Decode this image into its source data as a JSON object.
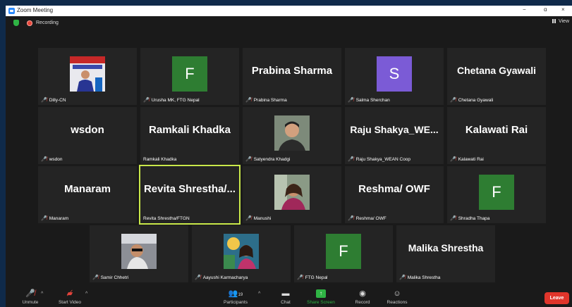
{
  "window": {
    "title": "Zoom Meeting",
    "minimize": "−",
    "restore": "ɑ",
    "close": "×"
  },
  "status": {
    "recording_label": "Recording",
    "view_label": "View"
  },
  "tiles": {
    "dilly": {
      "label": "Dilly-CN",
      "muted": true
    },
    "urusha": {
      "label": "Urusha MK, FTG Nepal",
      "avatar_letter": "F",
      "avatar_color": "#2e7d32",
      "muted": true
    },
    "prabina": {
      "big_name": "Prabina Sharma",
      "label": "Prabina Sharma",
      "muted": true
    },
    "salma": {
      "label": "Salma Sherchan",
      "avatar_letter": "S",
      "avatar_color": "#7b5bd6",
      "muted": true
    },
    "chetana": {
      "big_name": "Chetana Gyawali",
      "label": "Chetana Gyawali",
      "muted": true
    },
    "wsdon": {
      "big_name": "wsdon",
      "label": "wsdon",
      "muted": true
    },
    "ramkali": {
      "big_name": "Ramkali Khadka",
      "label": "Ramkali Khadka",
      "muted": false
    },
    "satyendra": {
      "label": "Satyendra Khadgi",
      "muted": true
    },
    "raju": {
      "big_name": "Raju  Shakya_WE...",
      "label": "Raju Shakya_WEAN Coop",
      "muted": true
    },
    "kalawati": {
      "big_name": "Kalawati Rai",
      "label": "Kalawati Rai",
      "muted": true
    },
    "manaram": {
      "big_name": "Manaram",
      "label": "Manaram",
      "muted": true
    },
    "revita": {
      "big_name": "Revita  Shrestha/...",
      "label": "Revita Shrestha/FTGN",
      "muted": false
    },
    "manushi": {
      "label": "Manushi",
      "muted": true
    },
    "reshma": {
      "big_name": "Reshma/ OWF",
      "label": "Reshma/ OWF",
      "muted": true
    },
    "shradha": {
      "label": "Shradha Thapa",
      "avatar_letter": "F",
      "avatar_color": "#2e7d32",
      "muted": true
    },
    "samir": {
      "label": "Samir Chhetri",
      "muted": true
    },
    "aayushi": {
      "label": "Aayushi Karmacharya",
      "muted": true
    },
    "ftg": {
      "label": "FTG Nepal",
      "avatar_letter": "F",
      "avatar_color": "#2e7d32",
      "muted": true
    },
    "malika": {
      "big_name": "Malika Shrestha",
      "label": "Malika Shrestha",
      "muted": true
    }
  },
  "toolbar": {
    "unmute": "Unmute",
    "start_video": "Start Video",
    "participants": "Participants",
    "participants_count": "19",
    "chat": "Chat",
    "share_screen": "Share Screen",
    "record": "Record",
    "reactions": "Reactions",
    "leave": "Leave"
  },
  "colors": {
    "accent_green": "#2fb344",
    "active_speaker_border": "#c9e84a",
    "leave_red": "#e0352b",
    "mute_red": "#e2433b"
  }
}
